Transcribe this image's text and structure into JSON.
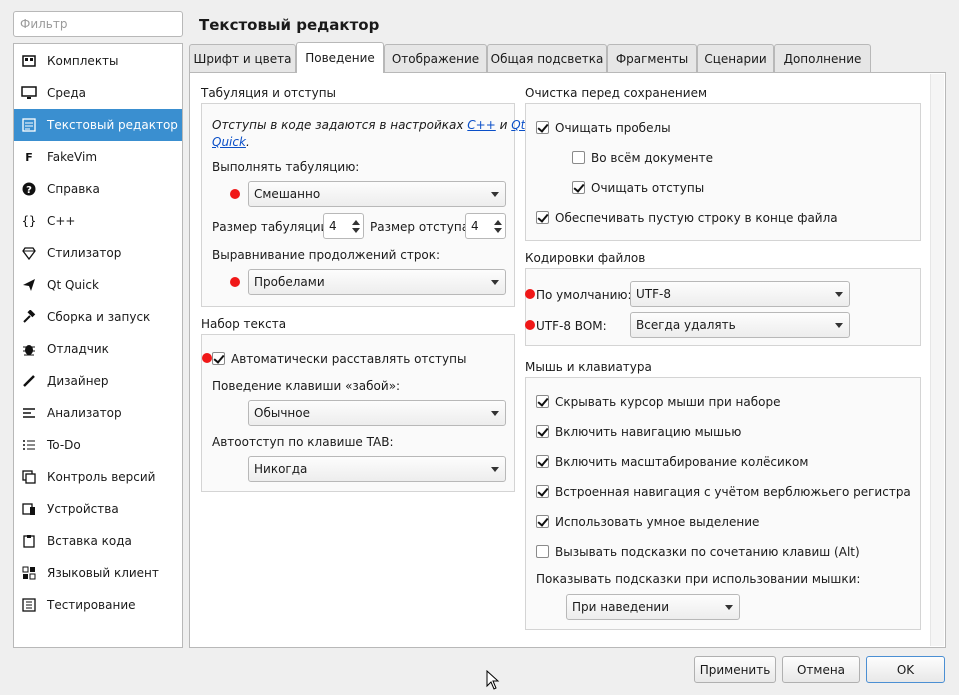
{
  "filter": {
    "placeholder": "Фильтр"
  },
  "sidebar": {
    "items": [
      {
        "label": "Комплекты",
        "icon": "kits-icon"
      },
      {
        "label": "Среда",
        "icon": "monitor-icon"
      },
      {
        "label": "Текстовый редактор",
        "icon": "text-editor-icon",
        "active": true
      },
      {
        "label": "FakeVim",
        "icon": "fakevim-icon"
      },
      {
        "label": "Справка",
        "icon": "help-icon"
      },
      {
        "label": "C++",
        "icon": "braces-icon"
      },
      {
        "label": "Стилизатор",
        "icon": "diamond-icon"
      },
      {
        "label": "Qt Quick",
        "icon": "qt-quick-icon"
      },
      {
        "label": "Сборка и запуск",
        "icon": "hammer-icon"
      },
      {
        "label": "Отладчик",
        "icon": "bug-icon"
      },
      {
        "label": "Дизайнер",
        "icon": "pencil-icon"
      },
      {
        "label": "Анализатор",
        "icon": "analyzer-icon"
      },
      {
        "label": "To-Do",
        "icon": "todo-list-icon"
      },
      {
        "label": "Контроль версий",
        "icon": "version-control-icon"
      },
      {
        "label": "Устройства",
        "icon": "devices-icon"
      },
      {
        "label": "Вставка кода",
        "icon": "paste-icon"
      },
      {
        "label": "Языковый клиент",
        "icon": "language-client-icon"
      },
      {
        "label": "Тестирование",
        "icon": "testing-icon"
      }
    ]
  },
  "header": {
    "title": "Текстовый редактор"
  },
  "tabs": [
    {
      "label": "Шрифт и цвета"
    },
    {
      "label": "Поведение",
      "active": true
    },
    {
      "label": "Отображение"
    },
    {
      "label": "Общая подсветка"
    },
    {
      "label": "Фрагменты"
    },
    {
      "label": "Сценарии"
    },
    {
      "label": "Дополнение"
    }
  ],
  "tabs_indent": {
    "title": "Табуляция и отступы",
    "note_prefix": "Отступы в коде задаются в настройках ",
    "note_link1": "C++",
    "note_mid": " и ",
    "note_link2a": "Qt",
    "note_link2b": "Quick",
    "note_suffix": ".",
    "tab_policy_label": "Выполнять табуляцию:",
    "tab_policy_value": "Смешанно",
    "tab_size_label": "Размер табуляции:",
    "tab_size_value": "4",
    "indent_size_label": "Размер отступа:",
    "indent_size_value": "4",
    "continuation_label": "Выравнивание продолжений строк:",
    "continuation_value": "Пробелами"
  },
  "typing": {
    "title": "Набор текста",
    "auto_indent_label": "Автоматически расставлять отступы",
    "auto_indent_checked": true,
    "backspace_label": "Поведение клавиши «забой»:",
    "backspace_value": "Обычное",
    "tab_key_label": "Автоотступ по клавише TAB:",
    "tab_key_value": "Никогда"
  },
  "cleanup": {
    "title": "Очистка перед сохранением",
    "clean_whitespace": {
      "label": "Очищать пробелы",
      "checked": true
    },
    "entire_document": {
      "label": "Во всём документе",
      "checked": false
    },
    "clean_indentation": {
      "label": "Очищать отступы",
      "checked": true
    },
    "ensure_newline": {
      "label": "Обеспечивать пустую строку в конце файла",
      "checked": true
    }
  },
  "encodings": {
    "title": "Кодировки файлов",
    "default_label": "По умолчанию:",
    "default_value": "UTF-8",
    "bom_label": "UTF-8 BOM:",
    "bom_value": "Всегда удалять"
  },
  "mouse": {
    "title": "Мышь и клавиатура",
    "hide_cursor": {
      "label": "Скрывать курсор мыши при наборе",
      "checked": true
    },
    "mouse_nav": {
      "label": "Включить навигацию мышью",
      "checked": true
    },
    "wheel_zoom": {
      "label": "Включить масштабирование колёсиком",
      "checked": true
    },
    "camel_nav": {
      "label": "Встроенная навигация с учётом верблюжьего регистра",
      "checked": true
    },
    "smart_select": {
      "label": "Использовать умное выделение",
      "checked": true
    },
    "keyboard_tooltips": {
      "label": "Вызывать подсказки по сочетанию клавиш (Alt)",
      "checked": false
    },
    "tooltips_label": "Показывать подсказки при использовании мышки:",
    "tooltips_value": "При наведении"
  },
  "buttons": {
    "apply": "Применить",
    "cancel": "Отмена",
    "ok": "OK"
  },
  "colors": {
    "accent": "#3a8fd0",
    "marker": "#f01818"
  }
}
